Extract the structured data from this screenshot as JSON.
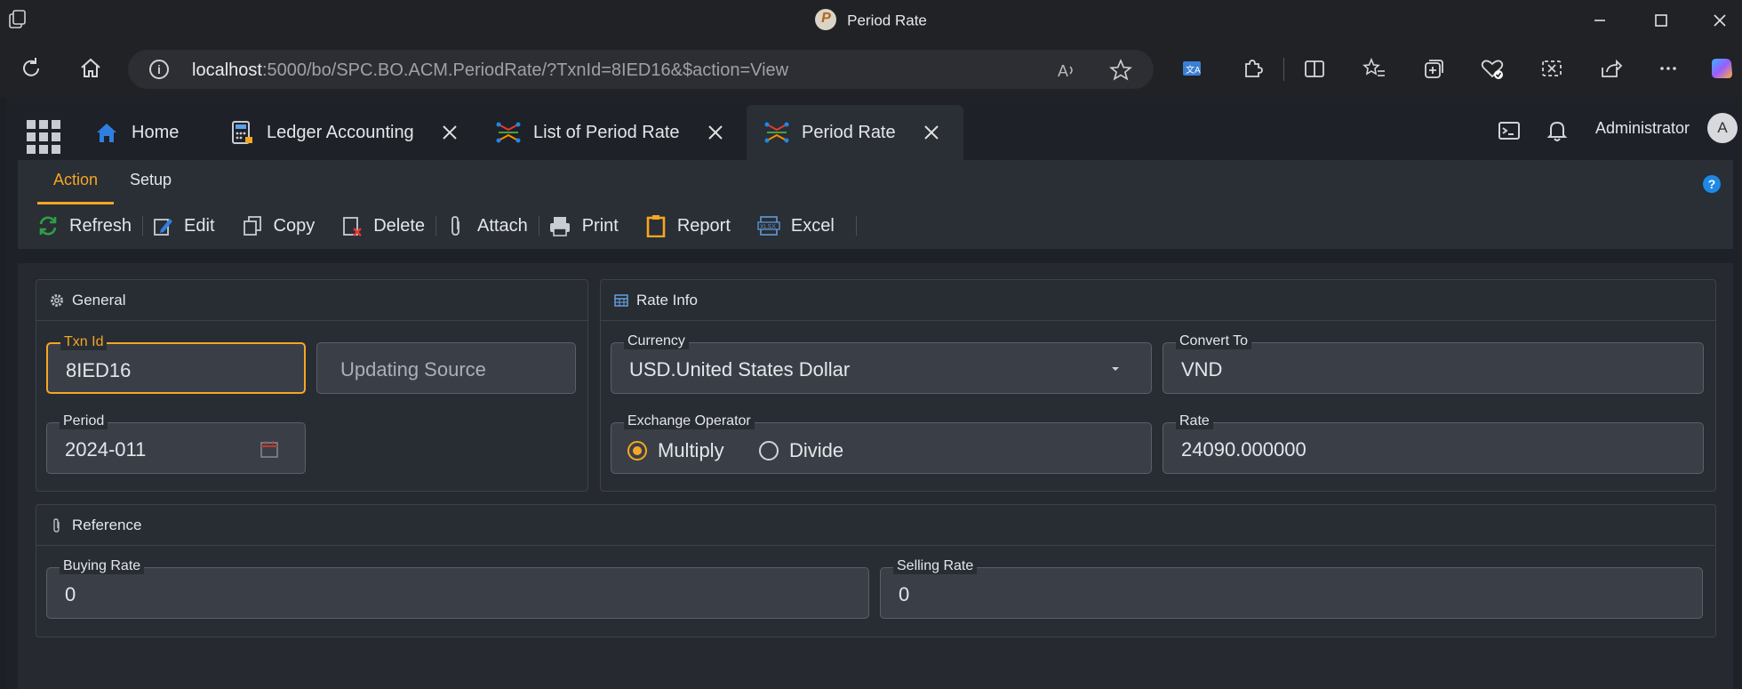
{
  "window": {
    "title": "Period Rate"
  },
  "browser": {
    "url_host": "localhost",
    "url_rest": ":5000/bo/SPC.BO.ACM.PeriodRate/?TxnId=8IED16&$action=View"
  },
  "tabs": [
    {
      "label": "Home",
      "icon": "home-icon"
    },
    {
      "label": "Ledger Accounting",
      "icon": "calculator-icon"
    },
    {
      "label": "List of Period Rate",
      "icon": "rate-icon"
    },
    {
      "label": "Period Rate",
      "icon": "rate-icon"
    }
  ],
  "user": {
    "name": "Administrator",
    "initial": "A"
  },
  "subtabs": [
    "Action",
    "Setup"
  ],
  "toolbar": {
    "refresh": "Refresh",
    "edit": "Edit",
    "copy": "Copy",
    "delete": "Delete",
    "attach": "Attach",
    "print": "Print",
    "report": "Report",
    "excel": "Excel"
  },
  "general": {
    "title": "General",
    "txn_id_label": "Txn Id",
    "txn_id": "8IED16",
    "updating_source": "Updating Source",
    "period_label": "Period",
    "period": "2024-011"
  },
  "rate_info": {
    "title": "Rate Info",
    "currency_label": "Currency",
    "currency": "USD.United States Dollar",
    "convert_to_label": "Convert To",
    "convert_to": "VND",
    "operator_label": "Exchange Operator",
    "operator_multiply": "Multiply",
    "operator_divide": "Divide",
    "rate_label": "Rate",
    "rate": "24090.000000"
  },
  "reference": {
    "title": "Reference",
    "buying_label": "Buying Rate",
    "buying": "0",
    "selling_label": "Selling Rate",
    "selling": "0"
  },
  "colors": {
    "accent": "#f5a623",
    "help": "#1e88e5"
  }
}
